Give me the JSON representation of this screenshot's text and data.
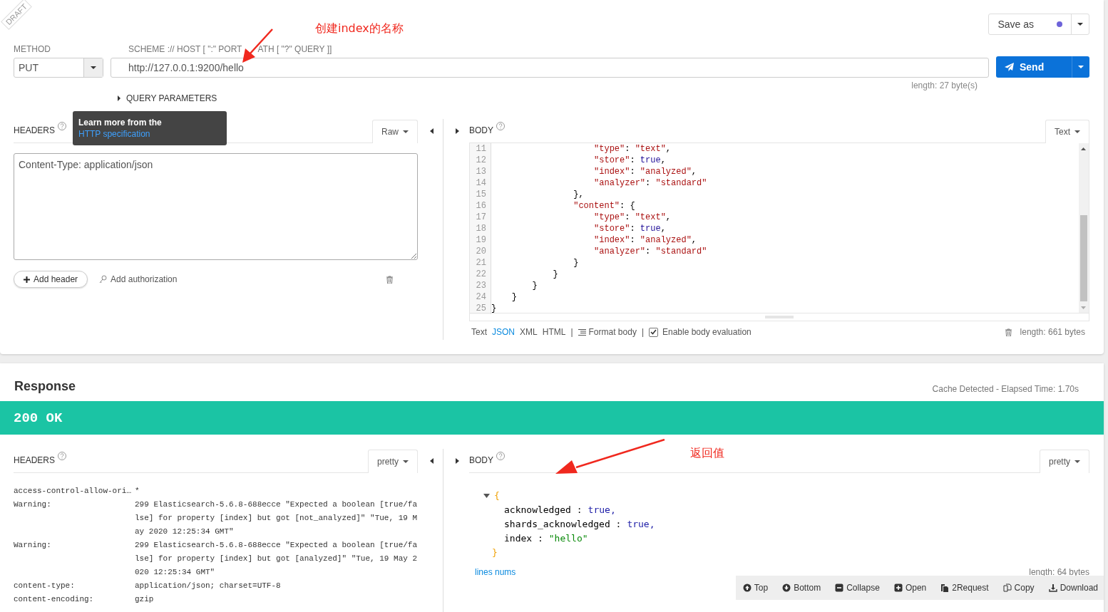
{
  "draft_ribbon": "DRAFT",
  "save_as": "Save as",
  "method": {
    "label": "METHOD",
    "value": "PUT"
  },
  "url": {
    "label": "SCHEME :// HOST [ \":\" PORT",
    "label_rest": "ATH [ \"?\" QUERY ]]",
    "value": "http://127.0.0.1:9200/hello",
    "length": "length: 27 byte(s)"
  },
  "send": "Send",
  "query_parameters": {
    "label": "QUERY PARAMETERS",
    "expanded": false
  },
  "request_headers": {
    "title": "HEADERS",
    "mode": "Raw",
    "value": "Content-Type: application/json",
    "add_header": "Add header",
    "add_authorization": "Add authorization"
  },
  "tooltip": {
    "text": "Learn more from the",
    "link": "HTTP specification"
  },
  "request_body": {
    "title": "BODY",
    "mode": "Text",
    "lines": [
      {
        "num": "11",
        "tokens": [
          {
            "kind": "key",
            "text": "                    \"type\""
          },
          {
            "kind": "punct",
            "text": ": "
          },
          {
            "kind": "str",
            "text": "\"text\""
          },
          {
            "kind": "punct",
            "text": ","
          }
        ]
      },
      {
        "num": "12",
        "tokens": [
          {
            "kind": "key",
            "text": "                    \"store\""
          },
          {
            "kind": "punct",
            "text": ": "
          },
          {
            "kind": "bool",
            "text": "true"
          },
          {
            "kind": "punct",
            "text": ","
          }
        ]
      },
      {
        "num": "13",
        "tokens": [
          {
            "kind": "key",
            "text": "                    \"index\""
          },
          {
            "kind": "punct",
            "text": ": "
          },
          {
            "kind": "str",
            "text": "\"analyzed\""
          },
          {
            "kind": "punct",
            "text": ","
          }
        ]
      },
      {
        "num": "14",
        "tokens": [
          {
            "kind": "key",
            "text": "                    \"analyzer\""
          },
          {
            "kind": "punct",
            "text": ": "
          },
          {
            "kind": "str",
            "text": "\"standard\""
          }
        ]
      },
      {
        "num": "15",
        "tokens": [
          {
            "kind": "punct",
            "text": "                },"
          }
        ]
      },
      {
        "num": "16",
        "tokens": [
          {
            "kind": "key",
            "text": "                \"content\""
          },
          {
            "kind": "punct",
            "text": ": {"
          }
        ]
      },
      {
        "num": "17",
        "tokens": [
          {
            "kind": "key",
            "text": "                    \"type\""
          },
          {
            "kind": "punct",
            "text": ": "
          },
          {
            "kind": "str",
            "text": "\"text\""
          },
          {
            "kind": "punct",
            "text": ","
          }
        ]
      },
      {
        "num": "18",
        "tokens": [
          {
            "kind": "key",
            "text": "                    \"store\""
          },
          {
            "kind": "punct",
            "text": ": "
          },
          {
            "kind": "bool",
            "text": "true"
          },
          {
            "kind": "punct",
            "text": ","
          }
        ]
      },
      {
        "num": "19",
        "tokens": [
          {
            "kind": "key",
            "text": "                    \"index\""
          },
          {
            "kind": "punct",
            "text": ": "
          },
          {
            "kind": "str",
            "text": "\"analyzed\""
          },
          {
            "kind": "punct",
            "text": ","
          }
        ]
      },
      {
        "num": "20",
        "tokens": [
          {
            "kind": "key",
            "text": "                    \"analyzer\""
          },
          {
            "kind": "punct",
            "text": ": "
          },
          {
            "kind": "str",
            "text": "\"standard\""
          }
        ]
      },
      {
        "num": "21",
        "tokens": [
          {
            "kind": "punct",
            "text": "                }"
          }
        ]
      },
      {
        "num": "22",
        "tokens": [
          {
            "kind": "punct",
            "text": "            }"
          }
        ]
      },
      {
        "num": "23",
        "tokens": [
          {
            "kind": "punct",
            "text": "        }"
          }
        ]
      },
      {
        "num": "24",
        "tokens": [
          {
            "kind": "punct",
            "text": "    }"
          }
        ]
      },
      {
        "num": "25",
        "tokens": [
          {
            "kind": "punct",
            "text": "}"
          }
        ]
      }
    ],
    "formats": [
      {
        "label": "Text",
        "selected": false
      },
      {
        "label": "JSON",
        "selected": true
      },
      {
        "label": "XML",
        "selected": false
      },
      {
        "label": "HTML",
        "selected": false
      }
    ],
    "separator": "|",
    "format_body": "Format body",
    "separator_2": "|",
    "enable_evaluation": {
      "label": "Enable body evaluation",
      "checked": true
    },
    "length": "length: 661 bytes"
  },
  "response": {
    "title": "Response",
    "timing": "Cache Detected - Elapsed Time: 1.70s",
    "status": "200 OK",
    "headers": {
      "title": "HEADERS",
      "mode": "pretty",
      "rows": [
        {
          "name": "access-control-allow-ori…",
          "value": "*"
        },
        {
          "name": "Warning:",
          "value": "299 Elasticsearch-5.6.8-688ecce \"Expected a boolean [true/false] for property [index] but got [not_analyzed]\" \"Tue, 19 May 2020 12:25:34 GMT\""
        },
        {
          "name": "Warning:",
          "value": "299 Elasticsearch-5.6.8-688ecce \"Expected a boolean [true/false] for property [index] but got [analyzed]\" \"Tue, 19 May 2020 12:25:34 GMT\""
        },
        {
          "name": "content-type:",
          "value": "application/json; charset=UTF-8"
        },
        {
          "name": "content-encoding:",
          "value": "gzip"
        }
      ]
    },
    "body": {
      "title": "BODY",
      "mode": "pretty",
      "expanded": true,
      "open_brace": "{",
      "close_brace": "}",
      "entries": [
        {
          "key": "acknowledged :",
          "value": "true,",
          "kind": "bool"
        },
        {
          "key": "shards_acknowledged :",
          "value": "true,",
          "kind": "bool"
        },
        {
          "key": "index :",
          "value": "\"hello\"",
          "kind": "string"
        }
      ],
      "lines_nums": "lines nums",
      "length": "length: 64 bytes",
      "toolbar": [
        {
          "label": "Top"
        },
        {
          "label": "Bottom"
        },
        {
          "label": "Collapse"
        },
        {
          "label": "Open"
        },
        {
          "label": "2Request"
        },
        {
          "label": "Copy"
        },
        {
          "label": "Download"
        }
      ]
    }
  },
  "annotations": [
    {
      "text": "创建index的名称"
    },
    {
      "text": "返回值"
    }
  ]
}
